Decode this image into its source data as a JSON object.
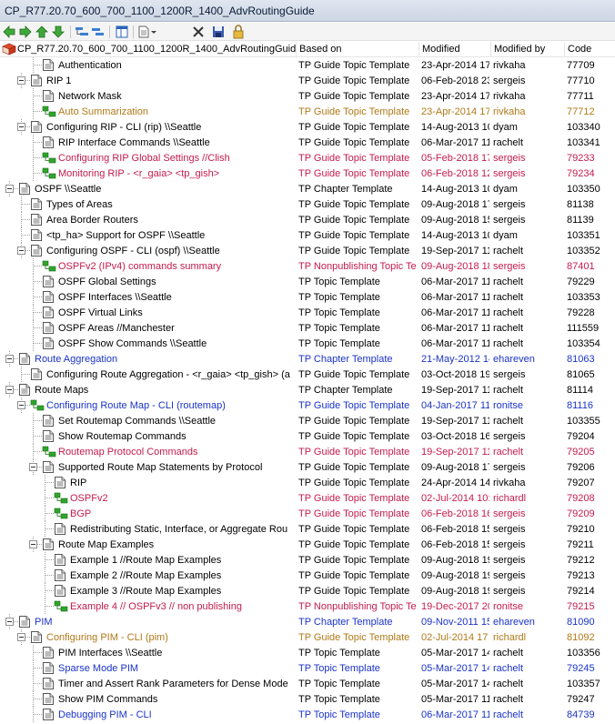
{
  "window": {
    "title": "CP_R77.20.70_600_700_1100_1200R_1400_AdvRoutingGuide"
  },
  "toolbar": {
    "buttons": [
      "back-icon",
      "forward-icon",
      "move-up-icon",
      "move-down-icon",
      "add-child-icon",
      "remove-icon",
      "layout-icon",
      "document-menu-icon",
      "delete-icon",
      "save-icon",
      "lock-icon"
    ]
  },
  "columns": [
    "Based on",
    "Modified",
    "Modified by",
    "Code"
  ],
  "root": {
    "label": "CP_R77.20.70_600_700_1100_1200R_1400_AdvRoutingGuide"
  },
  "colors": {
    "black": "#000000",
    "blue": "#1a33c7",
    "red": "#c41b4d",
    "orange": "#b07a18"
  },
  "rows": [
    {
      "label": "Authentication",
      "based_on": "TP Guide Topic Template",
      "modified": "23-Apr-2014 17",
      "by": "rivkaha",
      "code": "77709",
      "depth": 3,
      "icon": "doc",
      "color": "blk"
    },
    {
      "label": "RIP 1",
      "based_on": "TP Guide Topic Template",
      "modified": "06-Feb-2018 23",
      "by": "sergeis",
      "code": "77710",
      "depth": 2,
      "icon": "doc",
      "color": "blk",
      "exp": true
    },
    {
      "label": "Network Mask",
      "based_on": "TP Guide Topic Template",
      "modified": "23-Apr-2014 17",
      "by": "rivkaha",
      "code": "77711",
      "depth": 3,
      "icon": "doc",
      "color": "blk"
    },
    {
      "label": "Auto Summarization",
      "based_on": "TP Guide Topic Template",
      "modified": "23-Apr-2014 17",
      "by": "rivkaha",
      "code": "77712",
      "depth": 3,
      "icon": "green",
      "color": "org"
    },
    {
      "label": "Configuring RIP - CLI (rip) \\\\Seattle",
      "based_on": "TP Guide Topic Template",
      "modified": "14-Aug-2013 10",
      "by": "dyam",
      "code": "103340",
      "depth": 2,
      "icon": "doc",
      "color": "blk",
      "exp": true
    },
    {
      "label": "RIP Interface Commands \\\\Seattle",
      "based_on": "TP Guide Topic Template",
      "modified": "06-Mar-2017 11",
      "by": "rachelt",
      "code": "103341",
      "depth": 3,
      "icon": "doc",
      "color": "blk"
    },
    {
      "label": "Configuring RIP Global Settings //Clish",
      "based_on": "TP Guide Topic Template",
      "modified": "05-Feb-2018 17",
      "by": "sergeis",
      "code": "79233",
      "depth": 3,
      "icon": "green",
      "color": "red"
    },
    {
      "label": "Monitoring RIP - <r_gaia> <tp_gish>",
      "based_on": "TP Guide Topic Template",
      "modified": "06-Feb-2018 12",
      "by": "sergeis",
      "code": "79234",
      "depth": 3,
      "icon": "green",
      "color": "red"
    },
    {
      "label": "OSPF \\\\Seattle",
      "based_on": "TP Chapter Template",
      "modified": "14-Aug-2013 10",
      "by": "dyam",
      "code": "103350",
      "depth": 1,
      "icon": "doc",
      "color": "blk",
      "exp": true
    },
    {
      "label": "Types of Areas",
      "based_on": "TP Guide Topic Template",
      "modified": "09-Aug-2018 17",
      "by": "sergeis",
      "code": "81138",
      "depth": 2,
      "icon": "doc",
      "color": "blk"
    },
    {
      "label": "Area Border Routers",
      "based_on": "TP Guide Topic Template",
      "modified": "09-Aug-2018 15",
      "by": "sergeis",
      "code": "81139",
      "depth": 2,
      "icon": "doc",
      "color": "blk"
    },
    {
      "label": "<tp_ha> Support for OSPF \\\\Seattle",
      "based_on": "TP Guide Topic Template",
      "modified": "14-Aug-2013 10",
      "by": "dyam",
      "code": "103351",
      "depth": 2,
      "icon": "doc",
      "color": "blk"
    },
    {
      "label": "Configuring OSPF - CLI (ospf) \\\\Seattle",
      "based_on": "TP Guide Topic Template",
      "modified": "19-Sep-2017 11",
      "by": "rachelt",
      "code": "103352",
      "depth": 2,
      "icon": "doc",
      "color": "blk",
      "exp": true
    },
    {
      "label": "OSPFv2 (IPv4) commands summary",
      "based_on": "TP Nonpublishing Topic Te",
      "modified": "09-Aug-2018 18",
      "by": "sergeis",
      "code": "87401",
      "depth": 3,
      "icon": "green",
      "color": "red"
    },
    {
      "label": "OSPF Global Settings",
      "based_on": "TP Topic Template",
      "modified": "06-Mar-2017 11",
      "by": "rachelt",
      "code": "79229",
      "depth": 3,
      "icon": "doc",
      "color": "blk"
    },
    {
      "label": "OSPF Interfaces \\\\Seattle",
      "based_on": "TP Topic Template",
      "modified": "06-Mar-2017 11",
      "by": "rachelt",
      "code": "103353",
      "depth": 3,
      "icon": "doc",
      "color": "blk"
    },
    {
      "label": "OSPF Virtual Links",
      "based_on": "TP Topic Template",
      "modified": "06-Mar-2017 11",
      "by": "rachelt",
      "code": "79228",
      "depth": 3,
      "icon": "doc",
      "color": "blk"
    },
    {
      "label": "OSPF Areas //Manchester",
      "based_on": "TP Topic Template",
      "modified": "06-Mar-2017 11",
      "by": "rachelt",
      "code": "111559",
      "depth": 3,
      "icon": "doc",
      "color": "blk"
    },
    {
      "label": "OSPF Show Commands \\\\Seattle",
      "based_on": "TP Topic Template",
      "modified": "06-Mar-2017 11",
      "by": "rachelt",
      "code": "103354",
      "depth": 3,
      "icon": "doc",
      "color": "blk"
    },
    {
      "label": "Route Aggregation",
      "based_on": "TP Chapter Template",
      "modified": "21-May-2012 14",
      "by": "ehareven",
      "code": "81063",
      "depth": 1,
      "icon": "doc",
      "color": "blu",
      "exp": true
    },
    {
      "label": "Configuring Route Aggregation - <r_gaia> <tp_gish> (a",
      "based_on": "TP Guide Topic Template",
      "modified": "03-Oct-2018 19",
      "by": "sergeis",
      "code": "81065",
      "depth": 2,
      "icon": "doc",
      "color": "blk"
    },
    {
      "label": "Route Maps",
      "based_on": "TP Chapter Template",
      "modified": "19-Sep-2017 11",
      "by": "rachelt",
      "code": "81114",
      "depth": 1,
      "icon": "doc",
      "color": "blk",
      "exp": true
    },
    {
      "label": "Configuring Route Map - CLI (routemap)",
      "based_on": "TP Guide Topic Template",
      "modified": "04-Jan-2017 11",
      "by": "ronitse",
      "code": "81116",
      "depth": 2,
      "icon": "green",
      "color": "blu",
      "exp": true
    },
    {
      "label": "Set Routemap Commands \\\\Seattle",
      "based_on": "TP Guide Topic Template",
      "modified": "19-Sep-2017 11",
      "by": "rachelt",
      "code": "103355",
      "depth": 3,
      "icon": "doc",
      "color": "blk"
    },
    {
      "label": "Show Routemap Commands",
      "based_on": "TP Guide Topic Template",
      "modified": "03-Oct-2018 16",
      "by": "sergeis",
      "code": "79204",
      "depth": 3,
      "icon": "doc",
      "color": "blk"
    },
    {
      "label": "Routemap Protocol Commands",
      "based_on": "TP Guide Topic Template",
      "modified": "19-Sep-2017 11",
      "by": "rachelt",
      "code": "79205",
      "depth": 3,
      "icon": "green",
      "color": "red"
    },
    {
      "label": "Supported Route Map Statements by Protocol",
      "based_on": "TP Guide Topic Template",
      "modified": "09-Aug-2018 17",
      "by": "sergeis",
      "code": "79206",
      "depth": 3,
      "icon": "doc",
      "color": "blk",
      "exp": true
    },
    {
      "label": "RIP",
      "based_on": "TP Guide Topic Template",
      "modified": "24-Apr-2014 14",
      "by": "rivkaha",
      "code": "79207",
      "depth": 4,
      "icon": "doc",
      "color": "blk"
    },
    {
      "label": "OSPFv2",
      "based_on": "TP Guide Topic Template",
      "modified": "02-Jul-2014 10:",
      "by": "richardl",
      "code": "79208",
      "depth": 4,
      "icon": "green",
      "color": "red"
    },
    {
      "label": "BGP",
      "based_on": "TP Guide Topic Template",
      "modified": "06-Feb-2018 16",
      "by": "sergeis",
      "code": "79209",
      "depth": 4,
      "icon": "green",
      "color": "red"
    },
    {
      "label": "Redistributing Static, Interface, or Aggregate Rou",
      "based_on": "TP Guide Topic Template",
      "modified": "06-Feb-2018 15",
      "by": "sergeis",
      "code": "79210",
      "depth": 4,
      "icon": "doc",
      "color": "blk"
    },
    {
      "label": "Route Map Examples",
      "based_on": "TP Guide Topic Template",
      "modified": "06-Feb-2018 15",
      "by": "sergeis",
      "code": "79211",
      "depth": 3,
      "icon": "doc",
      "color": "blk",
      "exp": true
    },
    {
      "label": "Example 1 //Route Map Examples",
      "based_on": "TP Guide Topic Template",
      "modified": "09-Aug-2018 19",
      "by": "sergeis",
      "code": "79212",
      "depth": 4,
      "icon": "doc",
      "color": "blk"
    },
    {
      "label": "Example 2 //Route Map Examples",
      "based_on": "TP Guide Topic Template",
      "modified": "09-Aug-2018 19",
      "by": "sergeis",
      "code": "79213",
      "depth": 4,
      "icon": "doc",
      "color": "blk"
    },
    {
      "label": "Example 3 //Route Map Examples",
      "based_on": "TP Guide Topic Template",
      "modified": "09-Aug-2018 19",
      "by": "sergeis",
      "code": "79214",
      "depth": 4,
      "icon": "doc",
      "color": "blk"
    },
    {
      "label": "Example 4 // OSPFv3 // non publishing",
      "based_on": "TP Nonpublishing Topic Te",
      "modified": "19-Dec-2017 20",
      "by": "ronitse",
      "code": "79215",
      "depth": 4,
      "icon": "green",
      "color": "red"
    },
    {
      "label": "PIM",
      "based_on": "TP Chapter Template",
      "modified": "09-Nov-2011 15",
      "by": "ehareven",
      "code": "81090",
      "depth": 1,
      "icon": "doc",
      "color": "blu",
      "exp": true
    },
    {
      "label": "Configuring PIM - CLI (pim)",
      "based_on": "TP Guide Topic Template",
      "modified": "02-Jul-2014 17",
      "by": "richardl",
      "code": "81092",
      "depth": 2,
      "icon": "doc",
      "color": "org",
      "exp": true
    },
    {
      "label": "PIM Interfaces \\\\Seattle",
      "based_on": "TP Topic Template",
      "modified": "05-Mar-2017 14",
      "by": "rachelt",
      "code": "103356",
      "depth": 3,
      "icon": "doc",
      "color": "blk"
    },
    {
      "label": "Sparse Mode PIM",
      "based_on": "TP Topic Template",
      "modified": "05-Mar-2017 14",
      "by": "rachelt",
      "code": "79245",
      "depth": 3,
      "icon": "doc",
      "color": "blu"
    },
    {
      "label": "Timer and Assert Rank Parameters for Dense Mode",
      "based_on": "TP Topic Template",
      "modified": "05-Mar-2017 14",
      "by": "rachelt",
      "code": "103357",
      "depth": 3,
      "icon": "doc",
      "color": "blk"
    },
    {
      "label": "Show PIM Commands",
      "based_on": "TP Topic Template",
      "modified": "05-Mar-2017 11",
      "by": "rachelt",
      "code": "79247",
      "depth": 3,
      "icon": "doc",
      "color": "blk"
    },
    {
      "label": "Debugging PIM - CLI",
      "based_on": "TP Topic Template",
      "modified": "06-Mar-2017 11",
      "by": "rachelt",
      "code": "84739",
      "depth": 3,
      "icon": "doc",
      "color": "blu"
    }
  ]
}
